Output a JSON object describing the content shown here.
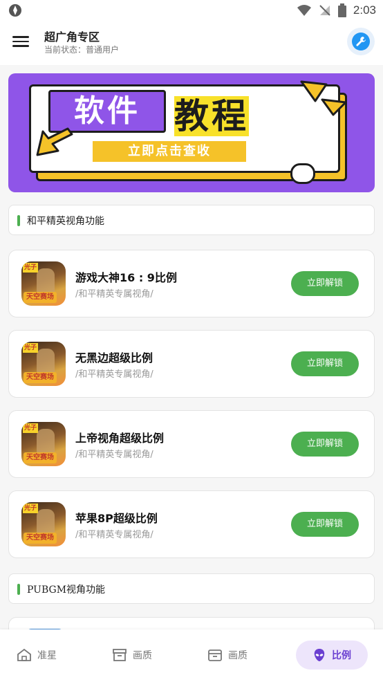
{
  "status_bar": {
    "time": "2:03"
  },
  "app_bar": {
    "title": "超广角专区",
    "subtitle": "当前状态：普通用户"
  },
  "banner": {
    "tag_purple": "软件",
    "tag_black": "教程",
    "cta": "立即点击查收"
  },
  "sections": [
    {
      "label": "和平精英视角功能"
    },
    {
      "label": "PUBGM视角功能"
    }
  ],
  "cards": [
    {
      "title": "游戏大神16 : 9比例",
      "subtitle": "/和平精英专属视角/",
      "button": "立即解锁",
      "thumb_tag1": "光子",
      "thumb_tag2": "天空赛场"
    },
    {
      "title": "无黑边超级比例",
      "subtitle": "/和平精英专属视角/",
      "button": "立即解锁",
      "thumb_tag1": "光子",
      "thumb_tag2": "天空赛场"
    },
    {
      "title": "上帝视角超级比例",
      "subtitle": "/和平精英专属视角/",
      "button": "立即解锁",
      "thumb_tag1": "光子",
      "thumb_tag2": "天空赛场"
    },
    {
      "title": "苹果8P超级比例",
      "subtitle": "/和平精英专属视角/",
      "button": "立即解锁",
      "thumb_tag1": "光子",
      "thumb_tag2": "天空赛场"
    }
  ],
  "tabs": [
    {
      "label": "准星",
      "icon": "home-icon",
      "active": false
    },
    {
      "label": "画质",
      "icon": "archive-box-icon",
      "active": false
    },
    {
      "label": "画质",
      "icon": "folder-box-icon",
      "active": false
    },
    {
      "label": "比例",
      "icon": "alien-icon",
      "active": true
    }
  ],
  "colors": {
    "accent_green": "#4caf50",
    "banner_purple": "#8f55e8",
    "tab_active": "#6a3fd1",
    "tool_blue": "#2196f3"
  }
}
